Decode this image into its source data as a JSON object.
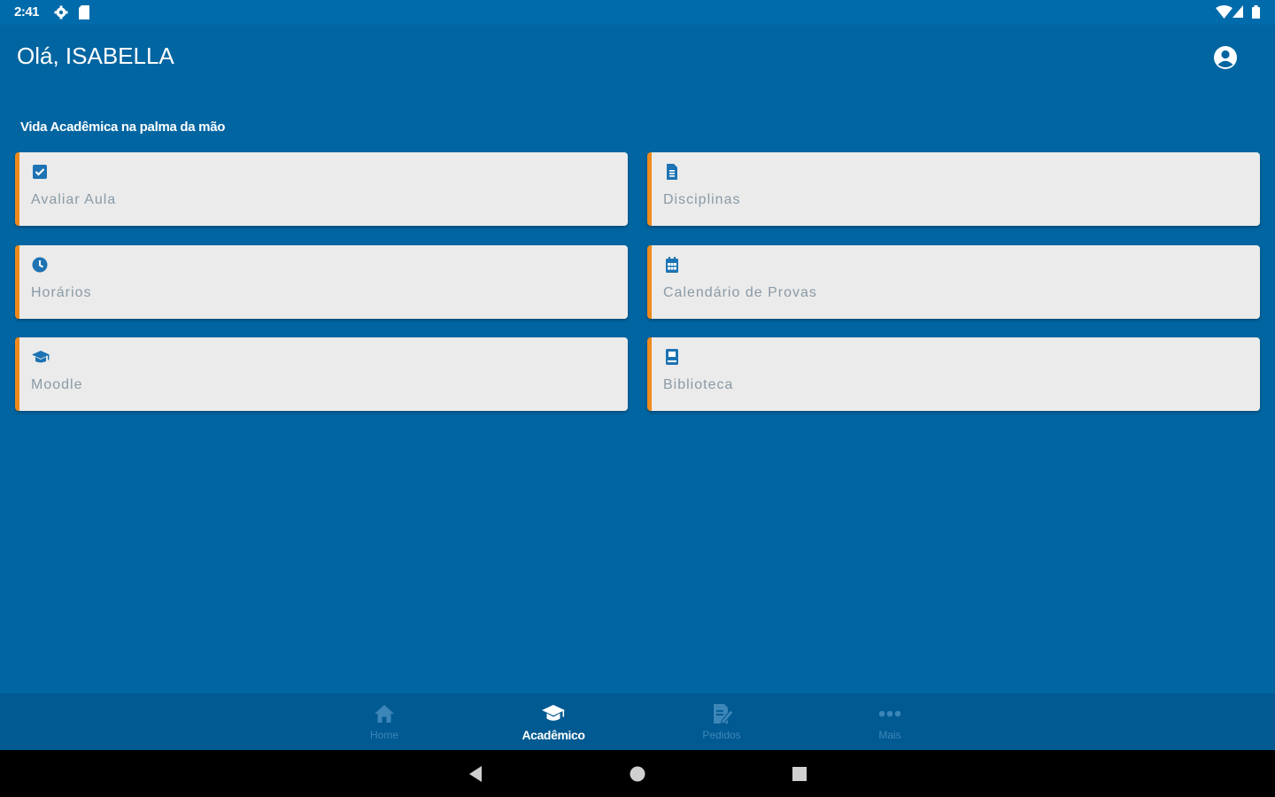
{
  "status_bar": {
    "time": "2:41",
    "icons": [
      "settings-icon",
      "sd-card-icon",
      "wifi-icon",
      "signal-icon",
      "battery-icon"
    ]
  },
  "header": {
    "greeting": "Olá, ISABELLA",
    "profile_icon": "account-circle-icon"
  },
  "section": {
    "title": "Vida Acadêmica na palma da mão"
  },
  "cards": [
    {
      "label": "Avaliar Aula",
      "icon": "checkbox-icon"
    },
    {
      "label": "Disciplinas",
      "icon": "document-icon"
    },
    {
      "label": "Horários",
      "icon": "clock-icon"
    },
    {
      "label": "Calendário de Provas",
      "icon": "calendar-icon"
    },
    {
      "label": "Moodle",
      "icon": "graduation-cap-icon"
    },
    {
      "label": "Biblioteca",
      "icon": "book-icon"
    }
  ],
  "bottom_nav": {
    "items": [
      {
        "label": "Home",
        "icon": "home-icon",
        "active": false
      },
      {
        "label": "Acadêmico",
        "icon": "graduation-cap-icon",
        "active": true
      },
      {
        "label": "Pedidos",
        "icon": "edit-document-icon",
        "active": false
      },
      {
        "label": "Mais",
        "icon": "more-dots-icon",
        "active": false
      }
    ]
  },
  "colors": {
    "background": "#0065a1",
    "card": "#ebebeb",
    "accent": "#f08a1c",
    "card_icon": "#1d73b3",
    "card_text": "#8a9aa6",
    "bottom_nav": "#015a92"
  }
}
